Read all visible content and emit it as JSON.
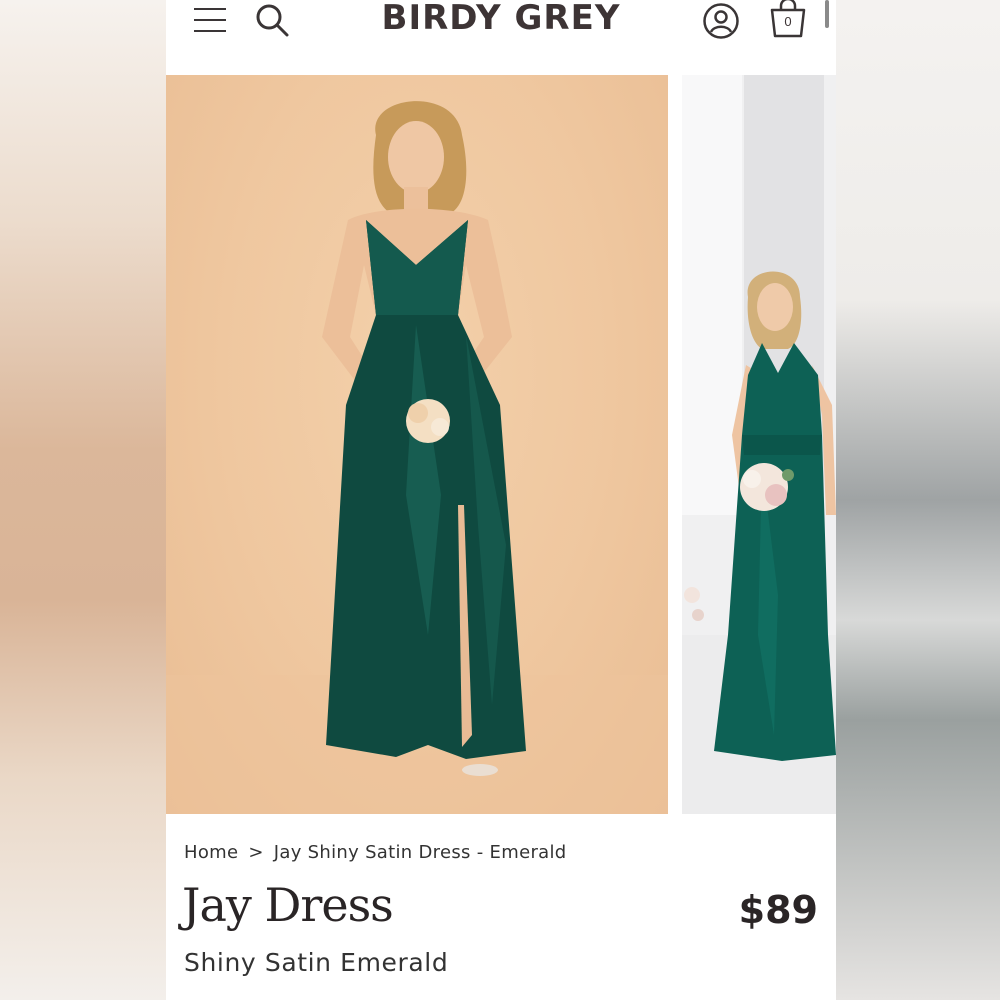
{
  "header": {
    "brand": "BIRDY GREY",
    "cart_count": "0",
    "icons": [
      "menu-icon",
      "search-icon",
      "account-icon",
      "cart-icon"
    ]
  },
  "gallery": {
    "images": [
      "main-product-photo",
      "secondary-product-photo"
    ]
  },
  "breadcrumb": {
    "home": "Home",
    "separator": ">",
    "current": "Jay Shiny Satin Dress - Emerald"
  },
  "product": {
    "title": "Jay Dress",
    "price": "$89",
    "subtitle": "Shiny Satin Emerald"
  },
  "colors": {
    "text": "#2a2526",
    "emerald": "#0f4a40",
    "backdrop_peach": "#efc79f"
  }
}
